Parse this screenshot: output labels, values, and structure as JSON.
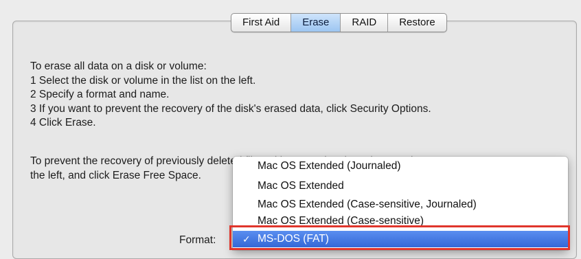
{
  "tabs": [
    {
      "label": "First Aid",
      "active": false
    },
    {
      "label": "Erase",
      "active": true
    },
    {
      "label": "RAID",
      "active": false
    },
    {
      "label": "Restore",
      "active": false
    }
  ],
  "instructions": [
    "To erase all data on a disk or volume:",
    "1 Select the disk or volume in the list on the left.",
    "2 Specify a format and name.",
    "3 If you want to prevent the recovery of the disk's erased data, click Security Options.",
    "4 Click Erase."
  ],
  "free_space_text": {
    "line1": "To prevent the recovery of previously deleted files without erasing the volume, select a",
    "line2": "the left, and click Erase Free Space."
  },
  "format": {
    "label": "Format:",
    "options": [
      "Mac OS Extended (Journaled)",
      "Mac OS Extended",
      "Mac OS Extended (Case-sensitive, Journaled)",
      "Mac OS Extended (Case-sensitive)",
      "MS-DOS (FAT)"
    ],
    "selected": "MS-DOS (FAT)",
    "check": "✓"
  },
  "colors": {
    "selection": "#3f74e0",
    "highlight_box": "#e0352b"
  }
}
